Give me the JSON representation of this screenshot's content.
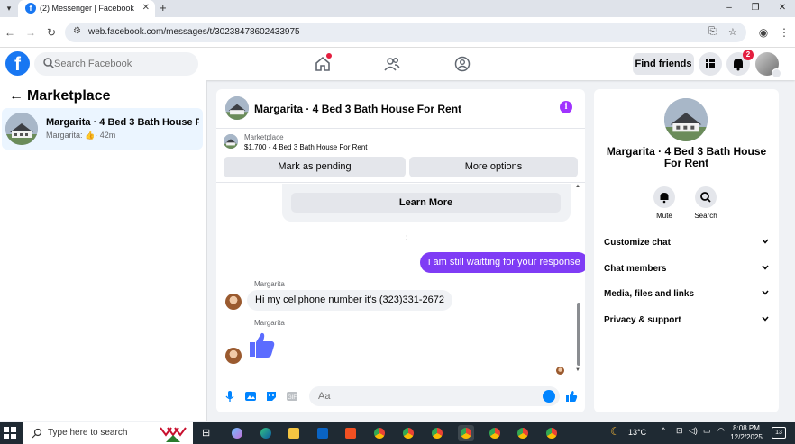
{
  "browser": {
    "tab_title": "(2) Messenger | Facebook",
    "new_tab": "+",
    "url": "web.facebook.com/messages/t/30238478602433975",
    "window_controls": [
      "–",
      "❐",
      "✕"
    ]
  },
  "fb_header": {
    "search_placeholder": "Search Facebook",
    "find_friends": "Find friends",
    "notifications_count": "2",
    "nav_icons": [
      "home-icon",
      "friends-icon",
      "groups-icon"
    ]
  },
  "sidebar": {
    "title": "Marketplace",
    "conversations": [
      {
        "name": "Margarita · 4 Bed 3 Bath House Fo...",
        "preview_sender": "Margarita:",
        "time": "· 42m"
      }
    ]
  },
  "chat": {
    "title": "Margarita · 4 Bed 3 Bath House For Rent",
    "marketplace_label": "Marketplace",
    "listing": "$1,700 - 4 Bed 3 Bath House For Rent",
    "mark_pending": "Mark as pending",
    "more_options": "More options",
    "learn_more": "Learn More",
    "typing_indicator": ":",
    "messages": [
      {
        "from": "me",
        "text": "i am still waitting for your response"
      },
      {
        "from": "Margarita",
        "sender_label": "Margarita",
        "text": "Hi my cellphone number it's (323)331-2672"
      },
      {
        "from": "Margarita",
        "sender_label": "Margarita",
        "type": "like-sticker"
      }
    ],
    "composer_placeholder": "Aa",
    "accent_color": "#7f3cf5"
  },
  "info_panel": {
    "title": "Margarita · 4 Bed 3 Bath House For Rent",
    "actions": [
      {
        "label": "Mute",
        "icon": "bell-icon"
      },
      {
        "label": "Search",
        "icon": "search-icon"
      }
    ],
    "sections": [
      "Customize chat",
      "Chat members",
      "Media, files and links",
      "Privacy & support"
    ]
  },
  "taskbar": {
    "search_placeholder": "Type here to search",
    "weather": "13°C",
    "time": "8:08 PM",
    "date": "12/2/2025",
    "notification_count": "13"
  }
}
